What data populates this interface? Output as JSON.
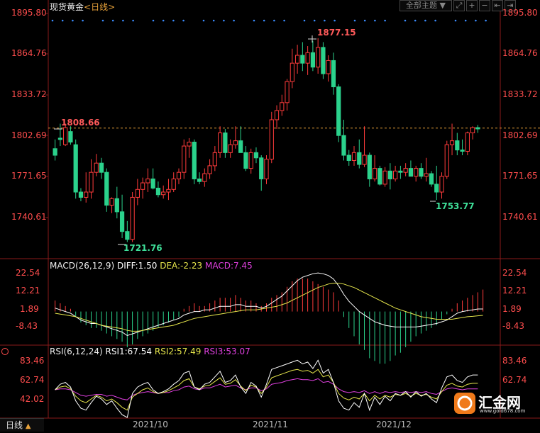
{
  "header": {
    "instrument": "现货黄金",
    "period_left": "<",
    "period": "日线",
    "period_right": ">",
    "theme_label": "全部主题",
    "theme_arrow": "▼",
    "icons": [
      "expand-icon",
      "zoom-in-icon",
      "zoom-out-icon",
      "prev-icon",
      "next-icon"
    ]
  },
  "price_axis": {
    "ticks": [
      "1895.80",
      "1864.76",
      "1833.72",
      "1802.69",
      "1771.65",
      "1740.61"
    ]
  },
  "macd_axis": {
    "ticks": [
      "22.54",
      "12.21",
      "1.89",
      "-8.43"
    ]
  },
  "rsi_axis": {
    "ticks": [
      "83.46",
      "62.74",
      "42.02"
    ]
  },
  "macd_title": {
    "name": "MACD(26,12,9)",
    "diff": "DIFF:1.50",
    "dea": "DEA:-2.23",
    "macd": "MACD:7.45"
  },
  "rsi_title": {
    "name": "RSI(6,12,24)",
    "rsi1": "RSI1:67.54",
    "rsi2": "RSI2:57.49",
    "rsi3": "RSI3:53.07"
  },
  "footer": {
    "period": "日线",
    "arrow": "▲",
    "dates": [
      "2021/10",
      "2021/11",
      "2021/12"
    ]
  },
  "annotations": {
    "last_close": "1808.66",
    "high": "1877.15",
    "low": "1721.76",
    "recent_low": "1753.77"
  },
  "logo": {
    "text": "汇金网",
    "url": "www.gold678.com"
  },
  "colors": {
    "up": "#ff3b3b",
    "down": "#2bd28c",
    "diff": "#ffffff",
    "dea": "#e6e64c",
    "macd": "#e040e0",
    "rsi1": "#ffffff",
    "rsi2": "#e6e64c",
    "rsi3": "#e040e0"
  },
  "chart_data": {
    "type": "candlestick",
    "ylim": [
      1715,
      1900
    ],
    "ohlc": [
      [
        1793,
        1800,
        1784,
        1788
      ],
      [
        1801,
        1812,
        1795,
        1800
      ],
      [
        1796,
        1812,
        1795,
        1809
      ],
      [
        1806,
        1810,
        1796,
        1798
      ],
      [
        1796,
        1800,
        1755,
        1760
      ],
      [
        1760,
        1763,
        1753,
        1756
      ],
      [
        1756,
        1775,
        1752,
        1760
      ],
      [
        1760,
        1785,
        1755,
        1775
      ],
      [
        1775,
        1789,
        1772,
        1782
      ],
      [
        1782,
        1786,
        1770,
        1775
      ],
      [
        1775,
        1778,
        1745,
        1750
      ],
      [
        1750,
        1756,
        1744,
        1755
      ],
      [
        1755,
        1764,
        1740,
        1745
      ],
      [
        1745,
        1758,
        1725,
        1730
      ],
      [
        1730,
        1738,
        1722,
        1724
      ],
      [
        1724,
        1760,
        1722,
        1756
      ],
      [
        1756,
        1770,
        1750,
        1762
      ],
      [
        1762,
        1771,
        1755,
        1767
      ],
      [
        1767,
        1778,
        1760,
        1770
      ],
      [
        1770,
        1778,
        1762,
        1763
      ],
      [
        1763,
        1768,
        1756,
        1758
      ],
      [
        1758,
        1765,
        1755,
        1760
      ],
      [
        1760,
        1770,
        1754,
        1762
      ],
      [
        1762,
        1775,
        1760,
        1770
      ],
      [
        1770,
        1778,
        1766,
        1775
      ],
      [
        1775,
        1800,
        1770,
        1795
      ],
      [
        1795,
        1801,
        1786,
        1798
      ],
      [
        1798,
        1800,
        1766,
        1770
      ],
      [
        1770,
        1775,
        1766,
        1768
      ],
      [
        1768,
        1778,
        1764,
        1774
      ],
      [
        1774,
        1785,
        1770,
        1780
      ],
      [
        1780,
        1795,
        1776,
        1790
      ],
      [
        1790,
        1810,
        1786,
        1805
      ],
      [
        1805,
        1808,
        1786,
        1790
      ],
      [
        1790,
        1800,
        1786,
        1796
      ],
      [
        1796,
        1810,
        1793,
        1799
      ],
      [
        1799,
        1810,
        1795,
        1790
      ],
      [
        1790,
        1795,
        1776,
        1778
      ],
      [
        1778,
        1793,
        1774,
        1790
      ],
      [
        1790,
        1794,
        1782,
        1786
      ],
      [
        1786,
        1788,
        1761,
        1770
      ],
      [
        1770,
        1788,
        1766,
        1785
      ],
      [
        1785,
        1821,
        1782,
        1815
      ],
      [
        1815,
        1826,
        1808,
        1822
      ],
      [
        1822,
        1834,
        1818,
        1828
      ],
      [
        1828,
        1846,
        1822,
        1844
      ],
      [
        1844,
        1869,
        1839,
        1858
      ],
      [
        1858,
        1872,
        1850,
        1864
      ],
      [
        1864,
        1874,
        1852,
        1858
      ],
      [
        1858,
        1871,
        1849,
        1866
      ],
      [
        1866,
        1875,
        1852,
        1855
      ],
      [
        1855,
        1877,
        1850,
        1870
      ],
      [
        1870,
        1874,
        1846,
        1850
      ],
      [
        1850,
        1864,
        1844,
        1860
      ],
      [
        1860,
        1866,
        1834,
        1840
      ],
      [
        1840,
        1842,
        1798,
        1803
      ],
      [
        1803,
        1815,
        1784,
        1788
      ],
      [
        1788,
        1792,
        1780,
        1784
      ],
      [
        1784,
        1795,
        1780,
        1790
      ],
      [
        1790,
        1800,
        1778,
        1781
      ],
      [
        1781,
        1810,
        1779,
        1788
      ],
      [
        1788,
        1790,
        1764,
        1770
      ],
      [
        1770,
        1788,
        1768,
        1778
      ],
      [
        1778,
        1780,
        1765,
        1766
      ],
      [
        1766,
        1779,
        1764,
        1776
      ],
      [
        1776,
        1782,
        1762,
        1770
      ],
      [
        1770,
        1780,
        1768,
        1776
      ],
      [
        1776,
        1780,
        1770,
        1775
      ],
      [
        1775,
        1782,
        1772,
        1778
      ],
      [
        1778,
        1784,
        1772,
        1772
      ],
      [
        1772,
        1780,
        1768,
        1778
      ],
      [
        1778,
        1782,
        1770,
        1772
      ],
      [
        1772,
        1786,
        1768,
        1774
      ],
      [
        1774,
        1776,
        1764,
        1766
      ],
      [
        1766,
        1780,
        1754,
        1760
      ],
      [
        1760,
        1775,
        1755,
        1772
      ],
      [
        1772,
        1799,
        1770,
        1796
      ],
      [
        1796,
        1812,
        1788,
        1799
      ],
      [
        1799,
        1805,
        1788,
        1792
      ],
      [
        1792,
        1800,
        1788,
        1791
      ],
      [
        1791,
        1806,
        1788,
        1805
      ],
      [
        1805,
        1810,
        1800,
        1809
      ],
      [
        1809,
        1811,
        1805,
        1808
      ]
    ],
    "macd_hist": [
      4,
      3,
      2,
      1,
      -2,
      -4,
      -5,
      -6,
      -6,
      -7,
      -8,
      -9,
      -10,
      -11,
      -13,
      -12,
      -10,
      -9,
      -8,
      -7,
      -6,
      -5,
      -4,
      -3,
      -2,
      1,
      2,
      3,
      2,
      2,
      3,
      4,
      5,
      5,
      5,
      6,
      5,
      4,
      4,
      3,
      2,
      3,
      5,
      6,
      7,
      9,
      11,
      12,
      12,
      12,
      11,
      10,
      9,
      8,
      7,
      4,
      -2,
      -6,
      -9,
      -12,
      -14,
      -17,
      -18,
      -19,
      -19,
      -18,
      -16,
      -15,
      -13,
      -11,
      -9,
      -8,
      -7,
      -6,
      -5,
      -3,
      -1,
      1,
      3,
      4,
      5,
      6,
      7,
      8
    ],
    "diff": [
      2,
      1,
      0,
      -1,
      -3,
      -5,
      -6,
      -7,
      -7,
      -8,
      -9,
      -10,
      -11,
      -12,
      -14,
      -13,
      -12,
      -11,
      -10,
      -9,
      -8,
      -7,
      -6,
      -5,
      -4,
      -2,
      -1,
      0,
      0,
      1,
      1,
      2,
      3,
      3,
      3,
      4,
      4,
      3,
      3,
      3,
      2,
      3,
      5,
      7,
      9,
      12,
      15,
      18,
      20,
      21,
      22,
      22.5,
      22,
      21,
      19,
      15,
      10,
      6,
      3,
      0,
      -2,
      -4,
      -6,
      -7,
      -8,
      -8.5,
      -9,
      -9,
      -9,
      -9,
      -9,
      -8.5,
      -8,
      -7.5,
      -7,
      -6,
      -5,
      -3,
      -1,
      0,
      0.5,
      1,
      1.5,
      1.5
    ],
    "dea": [
      -1,
      -1.5,
      -2,
      -2.5,
      -3,
      -4,
      -5,
      -6,
      -7,
      -8,
      -8.5,
      -9,
      -9.5,
      -10,
      -11,
      -11.5,
      -11.5,
      -11,
      -10.5,
      -10,
      -9.5,
      -9,
      -8.5,
      -8,
      -7,
      -6,
      -5,
      -4,
      -3.5,
      -3,
      -2.5,
      -2,
      -1.5,
      -1,
      -0.5,
      0,
      0.5,
      1,
      1,
      1,
      1.5,
      2,
      2.5,
      3,
      4,
      5,
      6.5,
      8,
      9.5,
      11,
      12.5,
      14,
      15,
      16,
      16.5,
      16.5,
      16,
      15,
      14,
      12.5,
      11,
      9.5,
      8,
      6.5,
      5,
      3.5,
      2,
      1,
      0,
      -1,
      -2,
      -3,
      -3.5,
      -4,
      -4.5,
      -4.5,
      -4.5,
      -4.5,
      -4,
      -3.5,
      -3,
      -2.8,
      -2.5,
      -2.23
    ],
    "rsi1": [
      52,
      58,
      60,
      55,
      40,
      32,
      30,
      38,
      45,
      42,
      36,
      40,
      32,
      25,
      22,
      48,
      55,
      58,
      60,
      52,
      48,
      50,
      53,
      58,
      62,
      70,
      72,
      55,
      52,
      58,
      60,
      66,
      72,
      60,
      62,
      68,
      55,
      48,
      60,
      56,
      44,
      58,
      74,
      76,
      78,
      80,
      82,
      84,
      80,
      82,
      75,
      84,
      70,
      74,
      60,
      40,
      32,
      30,
      38,
      33,
      48,
      30,
      44,
      36,
      45,
      40,
      48,
      46,
      50,
      44,
      50,
      45,
      48,
      42,
      38,
      54,
      66,
      68,
      62,
      60,
      66,
      68,
      68
    ],
    "rsi2": [
      52,
      55,
      56,
      53,
      45,
      40,
      38,
      42,
      46,
      44,
      40,
      42,
      38,
      33,
      30,
      44,
      48,
      52,
      54,
      50,
      48,
      49,
      51,
      54,
      57,
      62,
      64,
      55,
      53,
      56,
      57,
      61,
      65,
      58,
      59,
      63,
      56,
      51,
      57,
      55,
      48,
      55,
      65,
      67,
      69,
      71,
      73,
      74,
      72,
      73,
      70,
      74,
      66,
      68,
      60,
      48,
      43,
      41,
      44,
      42,
      48,
      40,
      46,
      42,
      46,
      44,
      47,
      46,
      48,
      45,
      48,
      46,
      47,
      44,
      42,
      50,
      57,
      59,
      56,
      55,
      58,
      59,
      59
    ],
    "rsi3": [
      52,
      53,
      53,
      52,
      49,
      46,
      45,
      46,
      47,
      47,
      45,
      46,
      44,
      42,
      41,
      46,
      48,
      49,
      50,
      49,
      48,
      49,
      49,
      51,
      52,
      55,
      56,
      53,
      52,
      54,
      54,
      56,
      58,
      55,
      56,
      57,
      54,
      52,
      54,
      54,
      51,
      53,
      58,
      59,
      60,
      62,
      63,
      64,
      63,
      63,
      62,
      64,
      60,
      61,
      58,
      53,
      50,
      49,
      50,
      49,
      51,
      48,
      50,
      48,
      50,
      49,
      50,
      49,
      50,
      49,
      50,
      49,
      50,
      48,
      47,
      50,
      53,
      54,
      53,
      52,
      53,
      53,
      53
    ]
  }
}
